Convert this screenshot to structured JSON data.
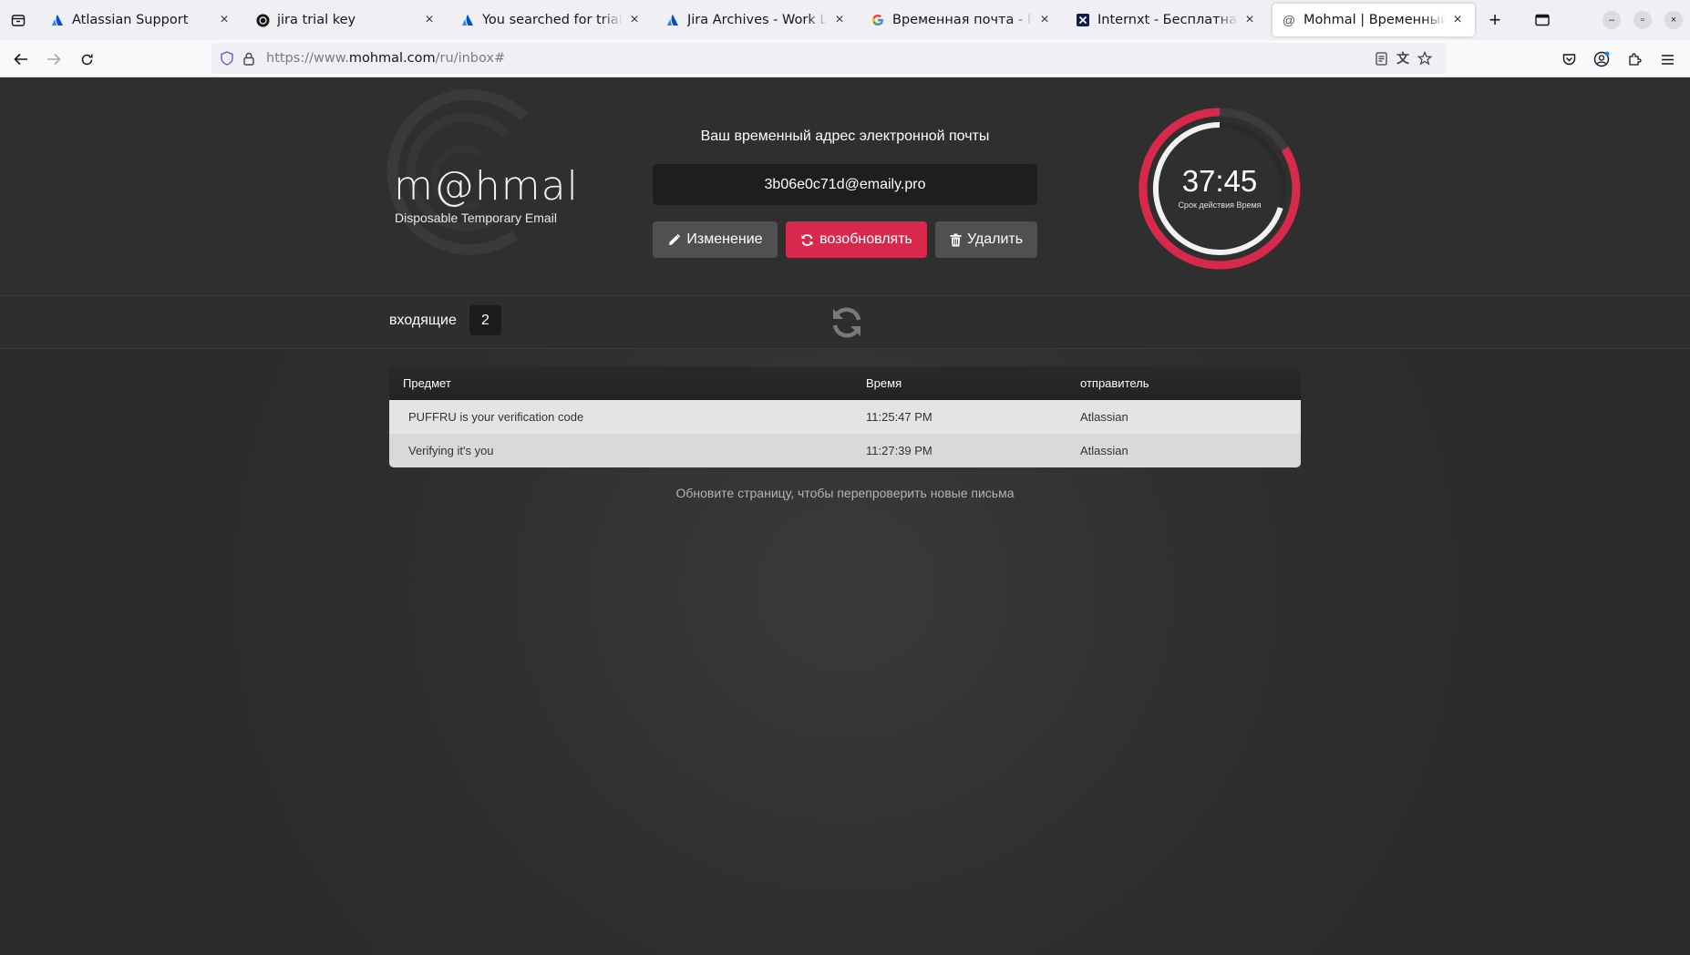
{
  "browser": {
    "tabs": [
      {
        "title": "Atlassian Support",
        "favicon": "atlassian-icon",
        "active": false
      },
      {
        "title": "jira trial key",
        "favicon": "openai-icon",
        "active": false
      },
      {
        "title": "You searched for trial - Work Life by Atlassian",
        "favicon": "atlassian-icon",
        "active": false
      },
      {
        "title": "Jira Archives - Work Life by Atlassian",
        "favicon": "atlassian-icon",
        "active": false
      },
      {
        "title": "Временная почта - Поиск в Google",
        "favicon": "google-icon",
        "active": false
      },
      {
        "title": "Internxt - Бесплатная временная почта",
        "favicon": "internxt-icon",
        "active": false
      },
      {
        "title": "Mohmal | Временный Email",
        "favicon": "at-icon",
        "active": true
      }
    ],
    "url": {
      "prefix": "https://www.",
      "host": "mohmal.com",
      "path": "/ru/inbox#"
    }
  },
  "header": {
    "logo": "m@hmal",
    "tagline": "Disposable Temporary Email",
    "address_title": "Ваш временный адрес электронной почты",
    "email": "3b06e0c71d@emaily.pro",
    "buttons": {
      "edit": "Изменение",
      "renew": "возобновлять",
      "delete": "Удалить"
    },
    "timer": {
      "value": "37:45",
      "label": "Срок действия Время"
    }
  },
  "inbox": {
    "label": "входящие",
    "count": "2"
  },
  "table": {
    "headers": {
      "subject": "Предмет",
      "time": "Время",
      "sender": "отправитель"
    },
    "rows": [
      {
        "subject": "PUFFRU is your verification code",
        "time": "11:25:47 PM",
        "sender": "Atlassian"
      },
      {
        "subject": "Verifying it's you",
        "time": "11:27:39 PM",
        "sender": "Atlassian"
      }
    ]
  },
  "footer_note": "Обновите страницу, чтобы перепроверить новые письма",
  "colors": {
    "accent": "#d8294c",
    "background": "#2b2b2b",
    "button_gray": "#505050"
  }
}
